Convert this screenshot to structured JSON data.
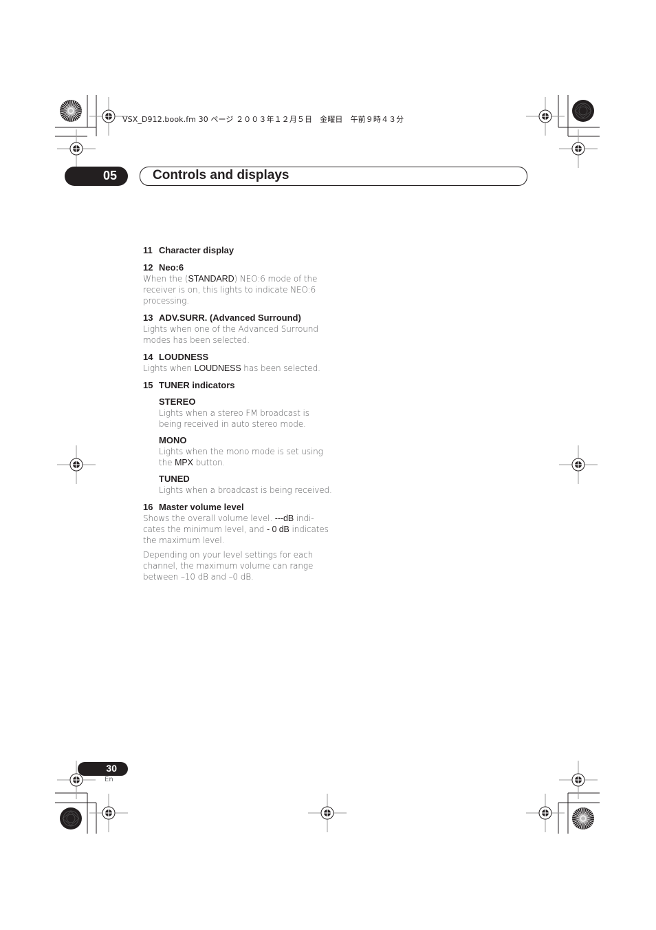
{
  "print_header": {
    "text": "VSX_D912.book.fm  30 ページ  ２００３年１２月５日　金曜日　午前９時４３分"
  },
  "chapter": {
    "number": "05",
    "title": "Controls and displays"
  },
  "items": [
    {
      "number": "11",
      "title": "Character display"
    },
    {
      "number": "12",
      "title": "Neo:6",
      "body": [
        {
          "t": "When the (",
          "b": false
        },
        {
          "t": "STANDARD",
          "b": true
        },
        {
          "t": ") NEO:6 mode of the receiver is on, this lights to indicate NEO:6 processing.",
          "b": false
        }
      ]
    },
    {
      "number": "13",
      "title": "ADV.SURR. (Advanced Surround)",
      "body": [
        {
          "t": "Lights when one of the Advanced Surround modes has been selected.",
          "b": false
        }
      ]
    },
    {
      "number": "14",
      "title": "LOUDNESS",
      "body": [
        {
          "t": "Lights when ",
          "b": false
        },
        {
          "t": "LOUDNESS",
          "b": true
        },
        {
          "t": " has been selected.",
          "b": false
        }
      ]
    },
    {
      "number": "15",
      "title": "TUNER indicators",
      "subitems": [
        {
          "title": "STEREO",
          "body": [
            {
              "t": "Lights when a stereo FM broadcast is being received in auto stereo mode.",
              "b": false
            }
          ]
        },
        {
          "title": "MONO",
          "body": [
            {
              "t": "Lights when the mono mode is set using the ",
              "b": false
            },
            {
              "t": "MPX",
              "b": true
            },
            {
              "t": " button.",
              "b": false
            }
          ]
        },
        {
          "title": "TUNED",
          "body": [
            {
              "t": "Lights when a broadcast is being received.",
              "b": false
            }
          ]
        }
      ]
    },
    {
      "number": "16",
      "title": "Master volume level",
      "body": [
        {
          "t": "Shows the overall volume level. ",
          "b": false
        },
        {
          "t": "---dB",
          "b": true
        },
        {
          "t": " indi­cates the minimum level, and ",
          "b": false
        },
        {
          "t": "- 0 dB",
          "b": true
        },
        {
          "t": " indicates the maximum level.",
          "b": false
        }
      ],
      "body2": [
        {
          "t": "Depending on your level settings for each channel, the maximum volume can range between –10 dB and –0 dB.",
          "b": false
        }
      ]
    }
  ],
  "footer": {
    "page_number": "30",
    "language": "En"
  },
  "print_marks": {
    "registration_mark_icon": "crosshair-circle",
    "color_target_icon": "radial-starburst"
  }
}
